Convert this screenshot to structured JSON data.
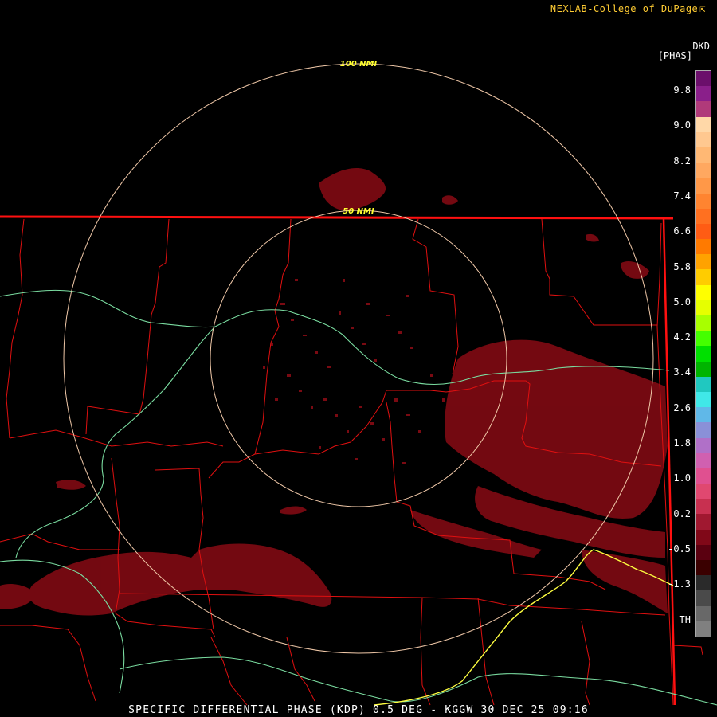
{
  "credit": "NEXLAB-College of DuPage",
  "credit_icon": "cursor-arrow-icon",
  "legend": {
    "product": "DKD",
    "units": "[PHAS]",
    "ticks": [
      "9.8",
      "9.0",
      "8.2",
      "7.4",
      "6.6",
      "5.8",
      "5.0",
      "4.2",
      "3.4",
      "2.6",
      "1.8",
      "1.0",
      "0.2",
      "-0.5",
      "-1.3",
      "TH"
    ],
    "colors": [
      "#6b0f6b",
      "#8a1f8a",
      "#b03a7a",
      "#ffd8a8",
      "#ffc890",
      "#ffb874",
      "#ffa860",
      "#ff9848",
      "#ff8430",
      "#ff7020",
      "#ff5c14",
      "#ff7a00",
      "#ffa200",
      "#ffcc00",
      "#ffff00",
      "#e6ff00",
      "#a8ff00",
      "#44ff00",
      "#00e000",
      "#00b400",
      "#20c8c0",
      "#40e8e8",
      "#60b8e8",
      "#8a90d8",
      "#b070c8",
      "#d060b0",
      "#e05090",
      "#e04870",
      "#c83050",
      "#a01830",
      "#800818",
      "#5a0010",
      "#3a0000",
      "#2a2a2a",
      "#4a4a4a",
      "#686868",
      "#808080"
    ]
  },
  "range_rings": [
    {
      "label": "100 NMI"
    },
    {
      "label": "50 NMI"
    }
  ],
  "caption": "SPECIFIC DIFFERENTIAL PHASE (KDP) 0.5 DEG - KGGW 30 DEC 25 09:16",
  "colors": {
    "echo": "#7a0a12",
    "boundary": "#e01010",
    "ring": "#f0c8a8",
    "river": "#7adca0",
    "highway": "#ffff40",
    "ring_label": "#ffff30"
  }
}
